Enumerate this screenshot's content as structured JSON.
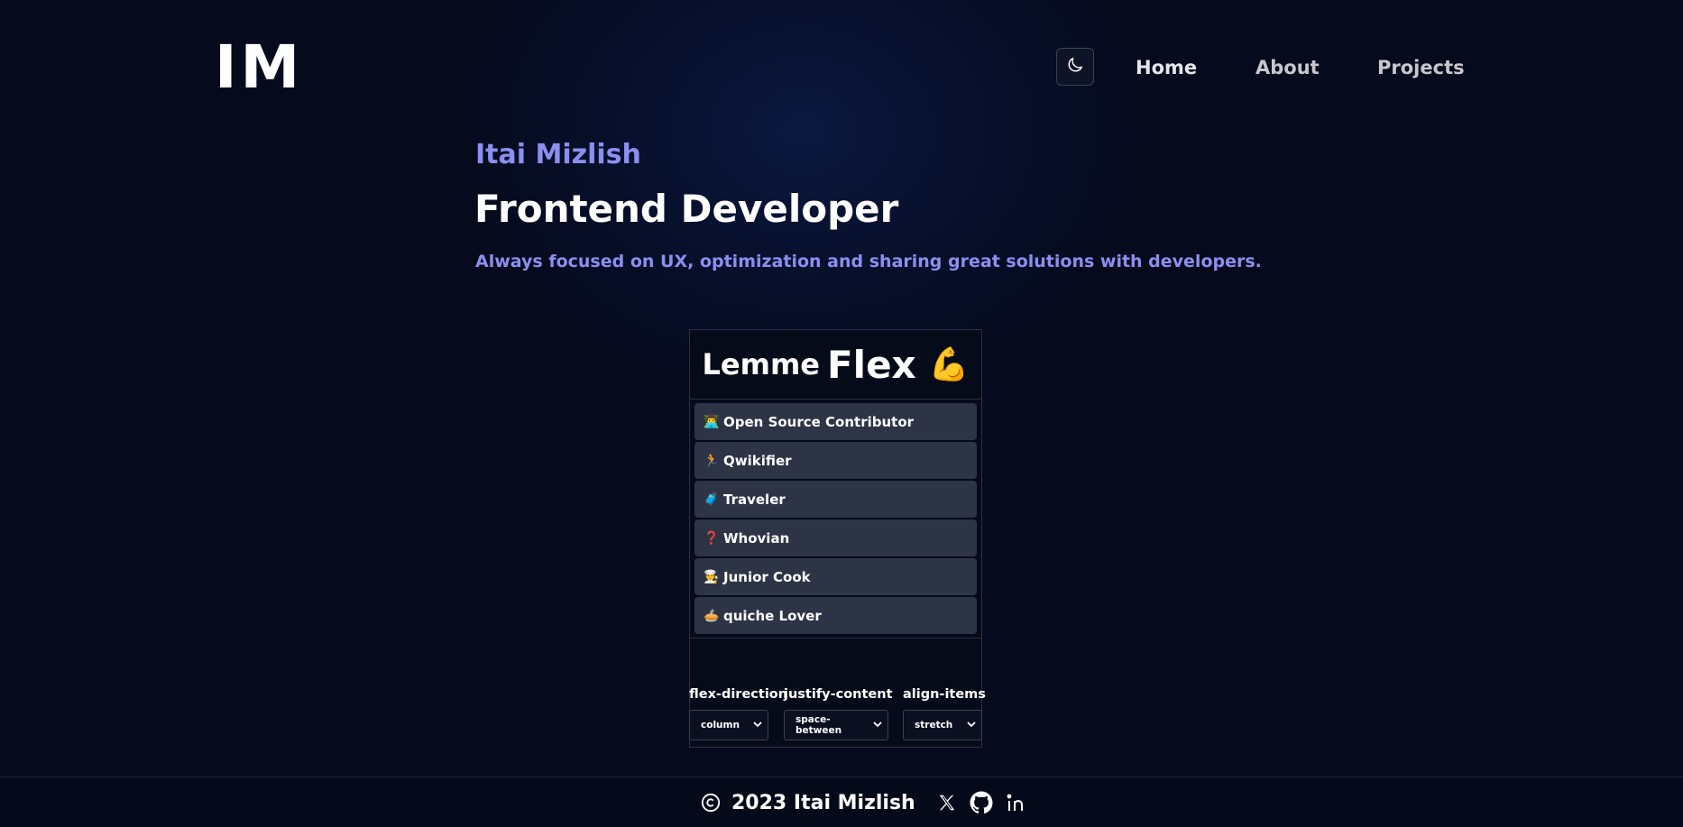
{
  "header": {
    "logo": "IM",
    "nav": [
      {
        "label": "Home"
      },
      {
        "label": "About"
      },
      {
        "label": "Projects"
      }
    ]
  },
  "hero": {
    "name": "Itai Mizlish",
    "title": "Frontend Developer",
    "tagline": "Always focused on UX, optimization and sharing great solutions with developers."
  },
  "flex_card": {
    "lemme": "Lemme",
    "flex": "Flex",
    "muscle_emoji": "💪",
    "items": [
      {
        "icon": "👨‍💻",
        "label": "Open Source Contributor"
      },
      {
        "icon": "🏃",
        "label": "Qwikifier"
      },
      {
        "icon": "🧳",
        "label": "Traveler"
      },
      {
        "icon": "❓",
        "label": "Whovian"
      },
      {
        "icon": "🧑‍🍳",
        "label": "Junior Cook"
      },
      {
        "icon": "🥧",
        "label": "quiche Lover"
      }
    ],
    "controls": [
      {
        "label": "flex-direction",
        "value": "column"
      },
      {
        "label": "justify-content",
        "value": "space-between"
      },
      {
        "label": "align-items",
        "value": "stretch"
      }
    ]
  },
  "footer": {
    "text": "2023 Itai Mizlish"
  },
  "icons": {
    "theme_toggle": "moon-icon",
    "copyright": "copyright-icon",
    "social": [
      "x-icon",
      "github-icon",
      "linkedin-icon"
    ]
  },
  "colors": {
    "background": "#050a1c",
    "accent": "#8b8ff0",
    "item_bg": "#2c3445"
  }
}
